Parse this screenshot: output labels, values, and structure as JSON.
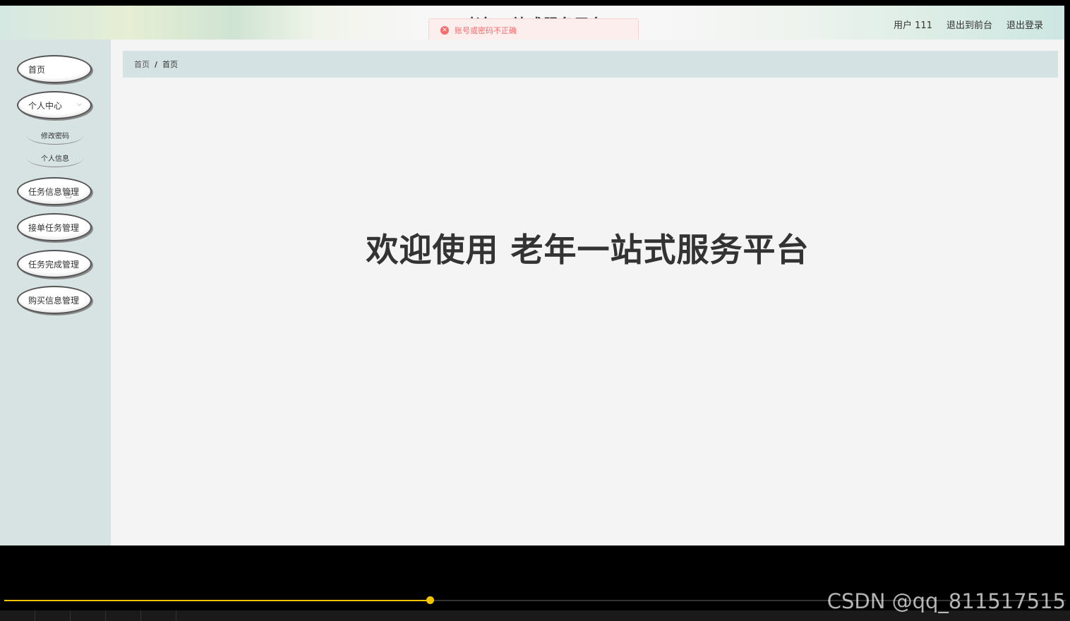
{
  "header": {
    "title": "老年一站式服务平台",
    "user_label": "用户 111",
    "front_link": "退出到前台",
    "logout_link": "退出登录"
  },
  "toast": {
    "icon": "error-circle-icon",
    "message": "账号或密码不正确"
  },
  "sidebar": {
    "items": [
      {
        "label": "首页"
      },
      {
        "label": "个人中心",
        "expanded": true,
        "children": [
          {
            "label": "修改密码"
          },
          {
            "label": "个人信息"
          }
        ]
      },
      {
        "label": "任务信息管理"
      },
      {
        "label": "接单任务管理"
      },
      {
        "label": "任务完成管理"
      },
      {
        "label": "购买信息管理"
      }
    ]
  },
  "breadcrumb": [
    "首页",
    "首页"
  ],
  "main": {
    "welcome": "欢迎使用 老年一站式服务平台"
  },
  "player": {
    "watermark": "CSDN @qq_811517515",
    "accent_color": "#f2c500"
  }
}
